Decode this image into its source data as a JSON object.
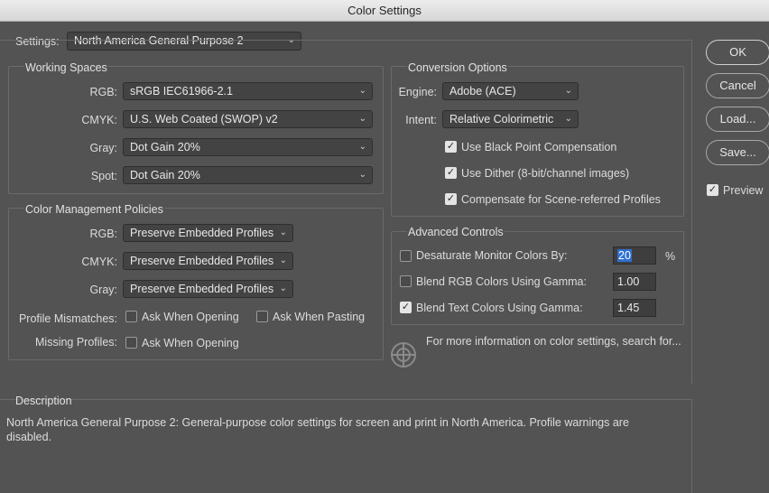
{
  "window": {
    "title": "Color Settings"
  },
  "settings": {
    "label": "Settings:",
    "value": "North America General Purpose 2"
  },
  "working_spaces": {
    "title": "Working Spaces",
    "rgb": {
      "label": "RGB:",
      "value": "sRGB IEC61966-2.1"
    },
    "cmyk": {
      "label": "CMYK:",
      "value": "U.S. Web Coated (SWOP) v2"
    },
    "gray": {
      "label": "Gray:",
      "value": "Dot Gain 20%"
    },
    "spot": {
      "label": "Spot:",
      "value": "Dot Gain 20%"
    }
  },
  "policies": {
    "title": "Color Management Policies",
    "rgb": {
      "label": "RGB:",
      "value": "Preserve Embedded Profiles"
    },
    "cmyk": {
      "label": "CMYK:",
      "value": "Preserve Embedded Profiles"
    },
    "gray": {
      "label": "Gray:",
      "value": "Preserve Embedded Profiles"
    },
    "mismatches": {
      "label": "Profile Mismatches:",
      "ask_opening": "Ask When Opening",
      "ask_pasting": "Ask When Pasting"
    },
    "missing": {
      "label": "Missing Profiles:",
      "ask_opening": "Ask When Opening"
    }
  },
  "conversion": {
    "title": "Conversion Options",
    "engine": {
      "label": "Engine:",
      "value": "Adobe (ACE)"
    },
    "intent": {
      "label": "Intent:",
      "value": "Relative Colorimetric"
    },
    "black_point": "Use Black Point Compensation",
    "dither": "Use Dither (8-bit/channel images)",
    "scene": "Compensate for Scene-referred Profiles"
  },
  "advanced": {
    "title": "Advanced Controls",
    "desaturate": {
      "label": "Desaturate Monitor Colors By:",
      "value": "20",
      "unit": "%"
    },
    "blend_rgb": {
      "label": "Blend RGB Colors Using Gamma:",
      "value": "1.00"
    },
    "blend_text": {
      "label": "Blend Text Colors Using Gamma:",
      "value": "1.45"
    }
  },
  "info": {
    "text": "For more information on color settings, search for..."
  },
  "description": {
    "title": "Description",
    "text": "North America General Purpose 2:  General-purpose color settings for screen and print in North America. Profile warnings are disabled."
  },
  "buttons": {
    "ok": "OK",
    "cancel": "Cancel",
    "load": "Load...",
    "save": "Save...",
    "preview": "Preview"
  },
  "icons": {
    "check": "✓",
    "chevron": "⌄"
  }
}
